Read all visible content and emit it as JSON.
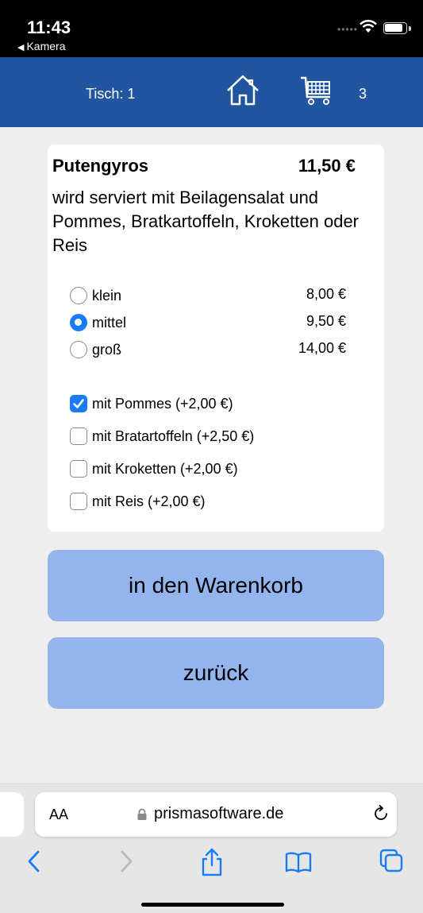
{
  "status_bar": {
    "time": "11:43",
    "back_app": "Kamera"
  },
  "header": {
    "table_label": "Tisch: 1",
    "cart_count": "3",
    "icons": [
      "home-icon",
      "cart-icon"
    ],
    "color": "#21559f"
  },
  "product": {
    "name": "Putengyros",
    "price": "11,50 €",
    "description": "wird serviert mit Beilagensalat und Pommes, Bratkartoffeln, Kroketten oder Reis"
  },
  "sizes": [
    {
      "label": "klein",
      "price": "8,00 €",
      "selected": false
    },
    {
      "label": "mittel",
      "price": "9,50 €",
      "selected": true
    },
    {
      "label": "groß",
      "price": "14,00 €",
      "selected": false
    }
  ],
  "extras": [
    {
      "label": "mit Pommes (+2,00 €)",
      "checked": true
    },
    {
      "label": "mit Bratartoffeln (+2,50 €)",
      "checked": false
    },
    {
      "label": "mit Kroketten (+2,00 €)",
      "checked": false
    },
    {
      "label": "mit Reis (+2,00 €)",
      "checked": false
    }
  ],
  "buttons": {
    "add_to_cart": "in den Warenkorb",
    "back": "zurück"
  },
  "browser": {
    "text_size_label": "AA",
    "url": "prismasoftware.de",
    "accent": "#1a7cf5"
  }
}
